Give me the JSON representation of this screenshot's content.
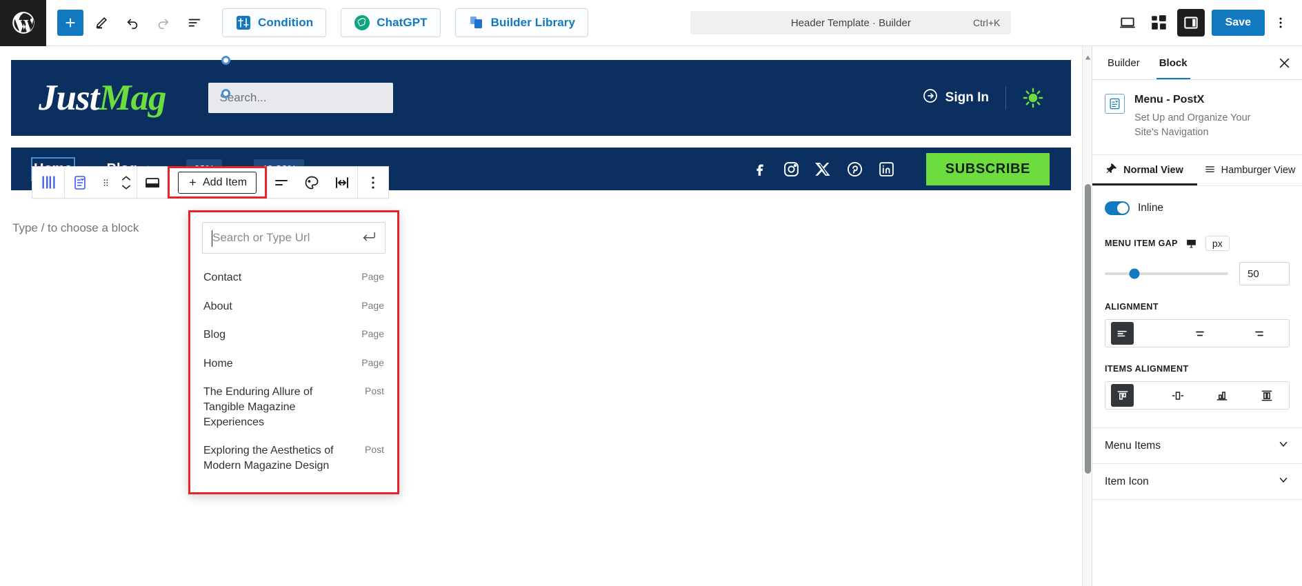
{
  "topbar": {
    "logo_icon": "wordpress-logo-icon",
    "add_block_label": "+",
    "tools": [
      {
        "name": "edit-pencil-icon",
        "label": "Edit"
      },
      {
        "name": "undo-icon",
        "label": "Undo"
      },
      {
        "name": "redo-icon",
        "label": "Redo"
      },
      {
        "name": "document-overview-icon",
        "label": "Document Overview"
      }
    ],
    "condition_label": "Condition",
    "chatgpt_label": "ChatGPT",
    "builder_library_label": "Builder Library",
    "command_title": "Header Template · Builder",
    "command_shortcut": "Ctrl+K",
    "view_desktop_icon": "desktop-view-icon",
    "patterns_icon": "patterns-icon",
    "settings_panel_icon": "settings-sidebar-icon",
    "save_label": "Save",
    "more_icon": "kebab-menu-icon"
  },
  "block_toolbar": {
    "parent_icon": "select-parent-columns-icon",
    "block_type_icon": "menu-block-icon",
    "drag_icon": "drag-handle-icon",
    "mover_up_icon": "move-up-icon",
    "mover_down_icon": "move-down-icon",
    "layout_icon": "layout-icon",
    "add_item_label": "Add Item",
    "align_icon": "align-icon",
    "palette_icon": "color-palette-icon",
    "width_icon": "full-width-icon",
    "options_icon": "more-options-icon"
  },
  "canvas": {
    "site_header": {
      "logo_first": "Just",
      "logo_second": "Mag",
      "search_placeholder": "Search...",
      "signin_label": "Sign In",
      "signin_icon": "arrow-circle-right-icon",
      "theme_toggle_icon": "sun-icon"
    },
    "site_nav": {
      "items": [
        {
          "label": "Home",
          "icon": null
        },
        {
          "label": "Blog",
          "icon": "arrow-down-icon"
        }
      ],
      "badges": [
        "68%",
        "49.32%"
      ],
      "socials": [
        "facebook-icon",
        "instagram-icon",
        "x-twitter-icon",
        "pinterest-icon",
        "linkedin-icon"
      ],
      "subscribe_label": "SUBSCRIBE"
    },
    "placeholder_text": "Type / to choose a block"
  },
  "link_popup": {
    "search_placeholder": "Search or Type Url",
    "submit_icon": "enter-return-icon",
    "results": [
      {
        "title": "Contact",
        "kind": "Page"
      },
      {
        "title": "About",
        "kind": "Page"
      },
      {
        "title": "Blog",
        "kind": "Page"
      },
      {
        "title": "Home",
        "kind": "Page"
      },
      {
        "title": "The Enduring Allure of Tangible Magazine Experiences",
        "kind": "Post"
      },
      {
        "title": "Exploring the Aesthetics of Modern Magazine Design",
        "kind": "Post"
      }
    ]
  },
  "sidebar": {
    "tabs": [
      {
        "label": "Builder",
        "active": false
      },
      {
        "label": "Block",
        "active": true
      }
    ],
    "close_icon": "close-icon",
    "block": {
      "icon": "menu-block-icon",
      "title": "Menu - PostX",
      "description": "Set Up and Organize Your Site's Navigation"
    },
    "view_tabs": [
      {
        "label": "Normal View",
        "icon": "pin-icon",
        "active": true
      },
      {
        "label": "Hamburger View",
        "icon": "hamburger-icon",
        "active": false
      }
    ],
    "inline": {
      "label": "Inline",
      "enabled": true
    },
    "menu_item_gap": {
      "label": "MENU ITEM GAP",
      "responsive_icon": "desktop-icon",
      "unit": "px",
      "value": "50"
    },
    "alignment": {
      "label": "ALIGNMENT",
      "options": [
        {
          "icon": "align-left-icon",
          "active": true
        },
        {
          "icon": "align-center-icon",
          "active": false
        },
        {
          "icon": "align-right-icon",
          "active": false
        }
      ]
    },
    "items_alignment": {
      "label": "ITEMS ALIGNMENT",
      "options": [
        {
          "icon": "items-align-start-icon",
          "active": true
        },
        {
          "icon": "items-align-center-icon",
          "active": false
        },
        {
          "icon": "items-align-end-icon",
          "active": false
        },
        {
          "icon": "items-align-stretch-icon",
          "active": false
        }
      ]
    },
    "accordions": [
      {
        "label": "Menu Items",
        "icon": "chevron-down-icon"
      },
      {
        "label": "Item Icon",
        "icon": "chevron-down-icon"
      }
    ]
  },
  "colors": {
    "accent_blue": "#1278c0",
    "brand_navy": "#0b2f5e",
    "brand_green": "#6ddc3e",
    "highlight_red": "#e8242a"
  }
}
